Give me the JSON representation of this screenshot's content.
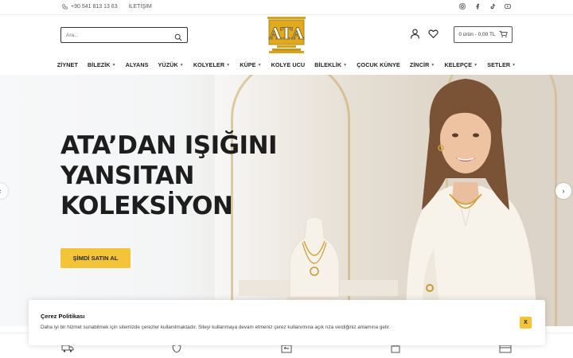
{
  "topbar": {
    "phone": "+90 541 813 13 63",
    "contact_label": "İLETİŞİM",
    "socials": [
      "instagram-icon",
      "facebook-icon",
      "tiktok-icon",
      "youtube-icon"
    ]
  },
  "header": {
    "search_placeholder": "Ara...",
    "logo_text": "ATA",
    "cart_label": "0 ürün - 0,00 TL"
  },
  "nav": {
    "items": [
      {
        "label": "ZİYNET",
        "dropdown": false
      },
      {
        "label": "BİLEZİK",
        "dropdown": true
      },
      {
        "label": "ALYANS",
        "dropdown": false
      },
      {
        "label": "YÜZÜK",
        "dropdown": true
      },
      {
        "label": "KOLYELER",
        "dropdown": true
      },
      {
        "label": "KÜPE",
        "dropdown": true
      },
      {
        "label": "KOLYE UCU",
        "dropdown": false
      },
      {
        "label": "BİLEKLİK",
        "dropdown": true
      },
      {
        "label": "ÇOCUK KÜNYE",
        "dropdown": false
      },
      {
        "label": "ZİNCİR",
        "dropdown": true
      },
      {
        "label": "KELEPÇE",
        "dropdown": true
      },
      {
        "label": "SETLER",
        "dropdown": true
      }
    ]
  },
  "hero": {
    "headline": [
      "ATA’DAN IŞIĞINI",
      "YANSITAN",
      "KOLEKSİYON"
    ],
    "cta_label": "ŞİMDİ SATIN AL",
    "prev_icon": "chevron-left-icon",
    "next_icon": "chevron-right-icon"
  },
  "cookie": {
    "title": "Çerez Politikası",
    "text": "Daha iyi bir hizmet sunabilmek için sitemizde çerezler kullanılmaktadır. Siteyi kullanmaya devam etmeniz çerez kullanımına açık rıza verdiğiniz anlamına gelir.",
    "close_label": "X"
  },
  "colors": {
    "accent": "#f3c338",
    "logo_gold": "#d9a31c",
    "text_dark": "#1d1d1d"
  }
}
